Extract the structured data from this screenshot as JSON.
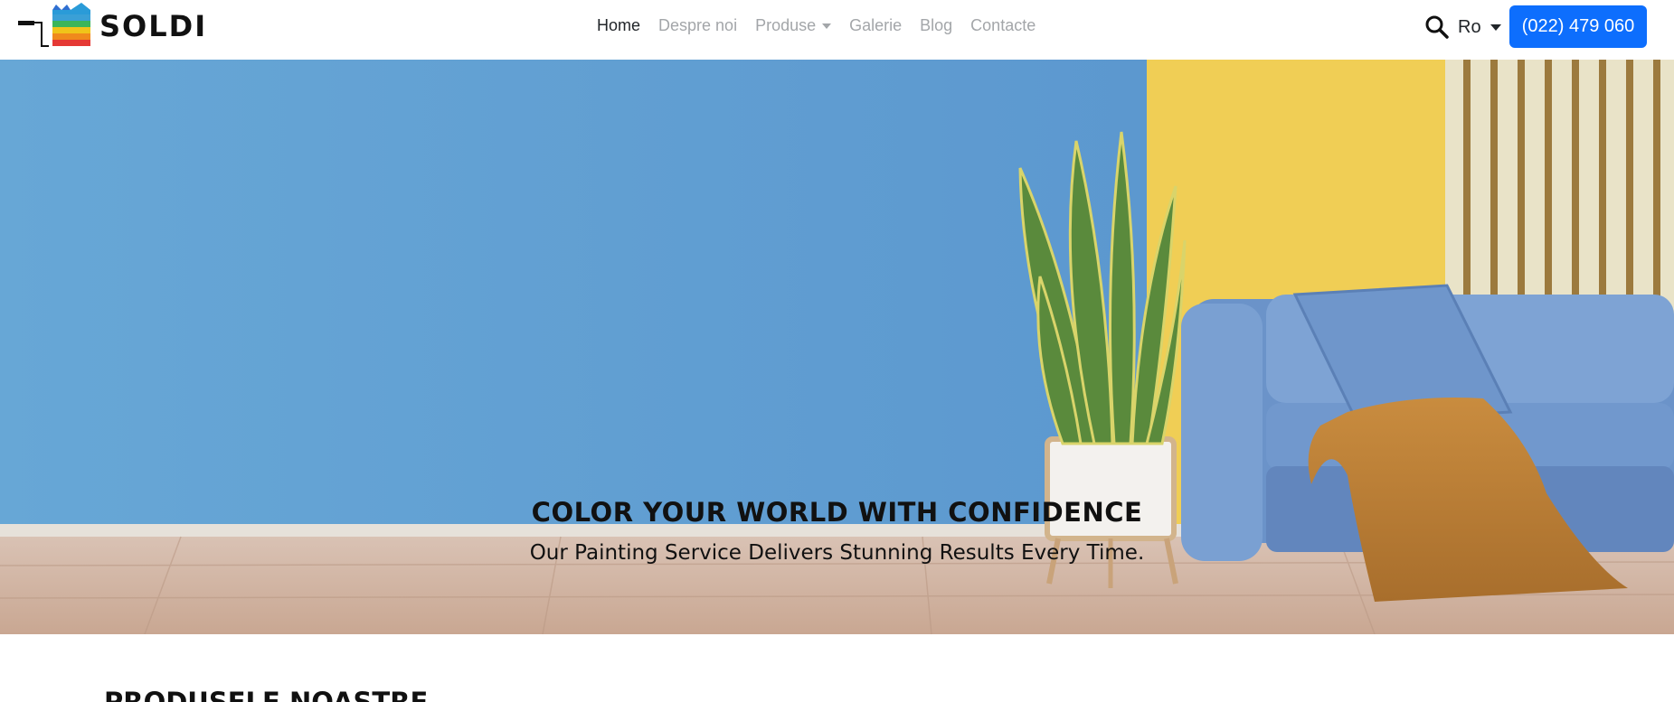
{
  "brand": {
    "name": "SOLDI"
  },
  "nav": {
    "items": [
      {
        "label": "Home",
        "active": true,
        "dropdown": false
      },
      {
        "label": "Despre noi",
        "active": false,
        "dropdown": false
      },
      {
        "label": "Produse",
        "active": false,
        "dropdown": true
      },
      {
        "label": "Galerie",
        "active": false,
        "dropdown": false
      },
      {
        "label": "Blog",
        "active": false,
        "dropdown": false
      },
      {
        "label": "Contacte",
        "active": false,
        "dropdown": false
      }
    ]
  },
  "search": {
    "icon": "search-icon"
  },
  "language": {
    "label": "Ro"
  },
  "phone": {
    "label": "(022) 479 060"
  },
  "hero": {
    "title": "COLOR YOUR WORLD WITH CONFIDENCE",
    "subtitle": "Our Painting Service Delivers Stunning Results Every Time."
  },
  "section": {
    "title": "PRODUSELE NOASTRE"
  },
  "colors": {
    "accent": "#0d6efd",
    "wall_blue": "#5f9fd0",
    "wall_yellow": "#f0ce55",
    "sofa": "#6b93c9"
  }
}
